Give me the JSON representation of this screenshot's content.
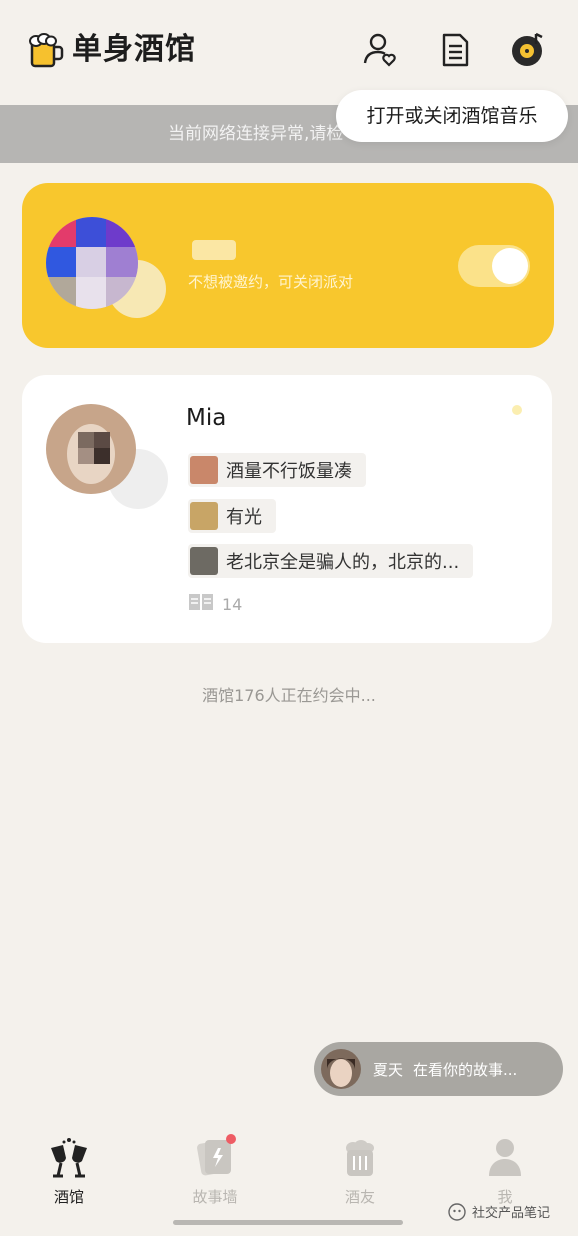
{
  "header": {
    "app_title": "单身酒馆",
    "logo_icon": "beer-mug-icon",
    "icons": [
      "user-heart-icon",
      "document-icon",
      "music-disc-icon"
    ]
  },
  "network_banner": {
    "text": "当前网络连接异常,请检"
  },
  "tooltip": {
    "text": "打开或关闭酒馆音乐"
  },
  "party_card": {
    "hint": "不想被邀约，可关闭派对",
    "toggle_on": true,
    "accent_color": "#f8c72d"
  },
  "profile": {
    "name": "Mia",
    "stories": [
      {
        "text": "酒量不行饭量凑"
      },
      {
        "text": "有光"
      },
      {
        "text": "老北京全是骗人的，北京的..."
      }
    ],
    "story_count": "14"
  },
  "online_status": "酒馆176人正在约会中...",
  "toast": {
    "name": "夏天",
    "message": "在看你的故事..."
  },
  "tabs": [
    {
      "label": "酒馆",
      "icon": "cheers-glasses-icon",
      "active": true
    },
    {
      "label": "故事墙",
      "icon": "story-cards-icon",
      "active": false,
      "badge": true
    },
    {
      "label": "酒友",
      "icon": "beer-cup-icon",
      "active": false
    },
    {
      "label": "我",
      "icon": "person-icon",
      "active": false
    }
  ],
  "watermark": "社交产品笔记"
}
